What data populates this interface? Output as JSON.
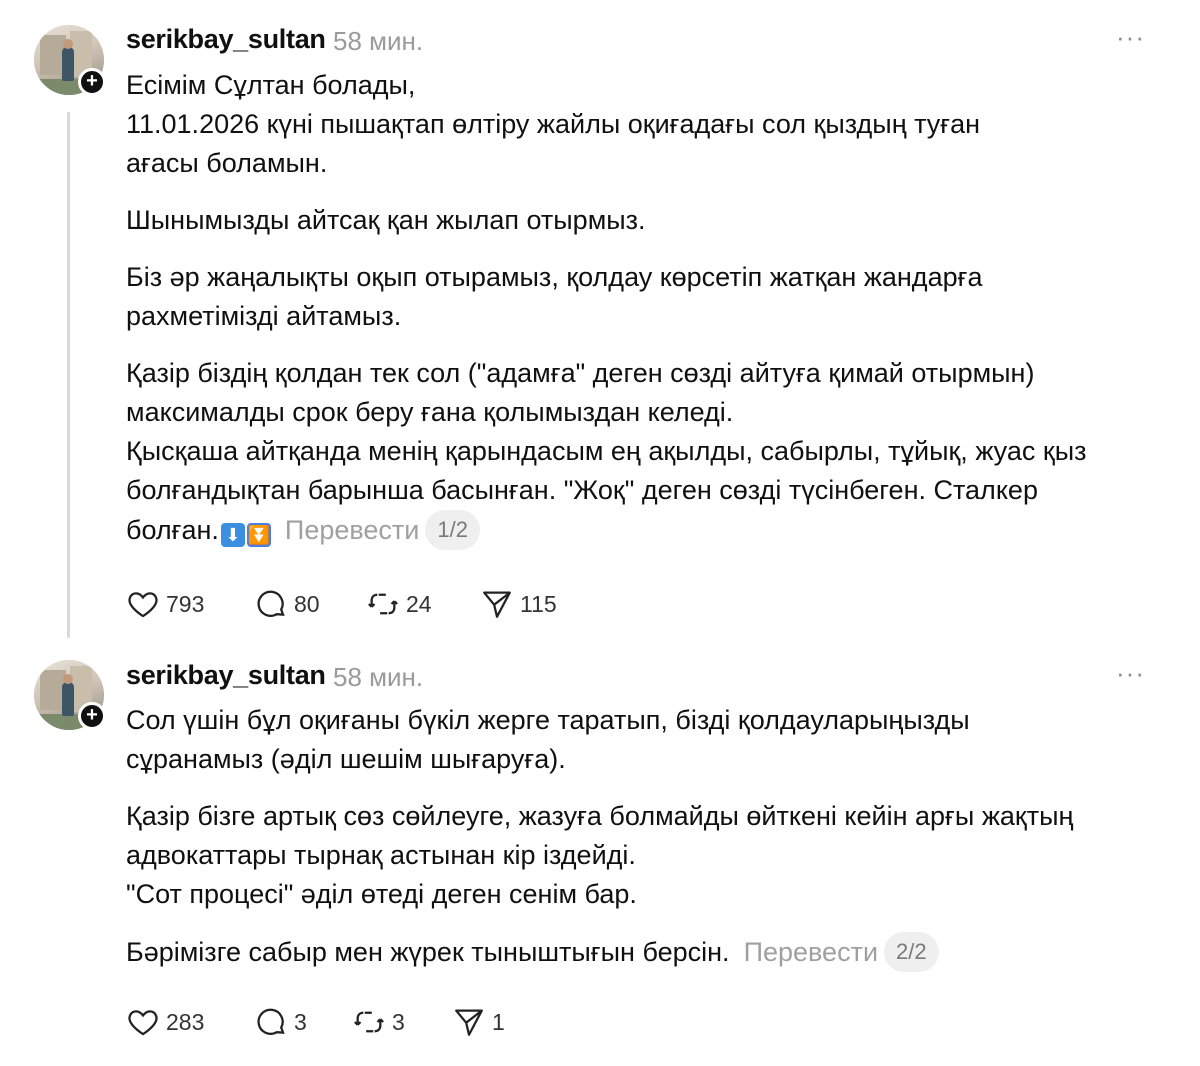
{
  "posts": [
    {
      "username": "serikbay_sultan",
      "time": "58 мин.",
      "more": "···",
      "paragraphs": [
        "Есімім Сұлтан болады,",
        "11.01.2026 күні пышақтап өлтіру жайлы оқиғадағы сол қыздың туған",
        "ағасы боламын.",
        "Шынымызды айтсақ қан жылап отырмыз.",
        "Біз әр жаңалықты оқып отырамыз, қолдау көрсетіп жатқан жандарға",
        "рахметімізді айтамыз.",
        "Қазір біздің қолдан тек сол (\"адамға\" деген сөзді айтуға қимай отырмын)",
        "максималды срок беру ғана қолымыздан келеді.",
        "Қысқаша айтқанда менің қарындасым ең ақылды, сабырлы, тұйық, жуас қыз",
        "болғандықтан барынша басынған. \"Жоқ\" деген сөзді түсінбеген. Сталкер",
        "болған."
      ],
      "emojis": [
        "⬇",
        "⏬"
      ],
      "translate": "Перевести",
      "page": "1/2",
      "likes": "793",
      "comments": "80",
      "reposts": "24",
      "shares": "115"
    },
    {
      "username": "serikbay_sultan",
      "time": "58 мин.",
      "more": "···",
      "paragraphs": [
        "Сол үшін бұл оқиғаны бүкіл жерге таратып, бізді қолдауларыңызды",
        "сұранамыз (әділ шешім шығаруға).",
        "Қазір бізге артық сөз сөйлеуге, жазуға болмайды өйткені кейін арғы жақтың",
        "адвокаттары тырнақ астынан кір іздейді.",
        "\"Сот процесі\" әділ өтеді деген сенім бар.",
        "Бәрімізге сабыр мен жүрек тыныштығын берсін."
      ],
      "translate": "Перевести",
      "page": "2/2",
      "likes": "283",
      "comments": "3",
      "reposts": "3",
      "shares": "1"
    }
  ],
  "icons": {
    "like": "heart-icon",
    "comment": "comment-bubble-icon",
    "repost": "repost-icon",
    "share": "send-icon",
    "follow": "plus-icon",
    "more": "more-options-icon"
  }
}
